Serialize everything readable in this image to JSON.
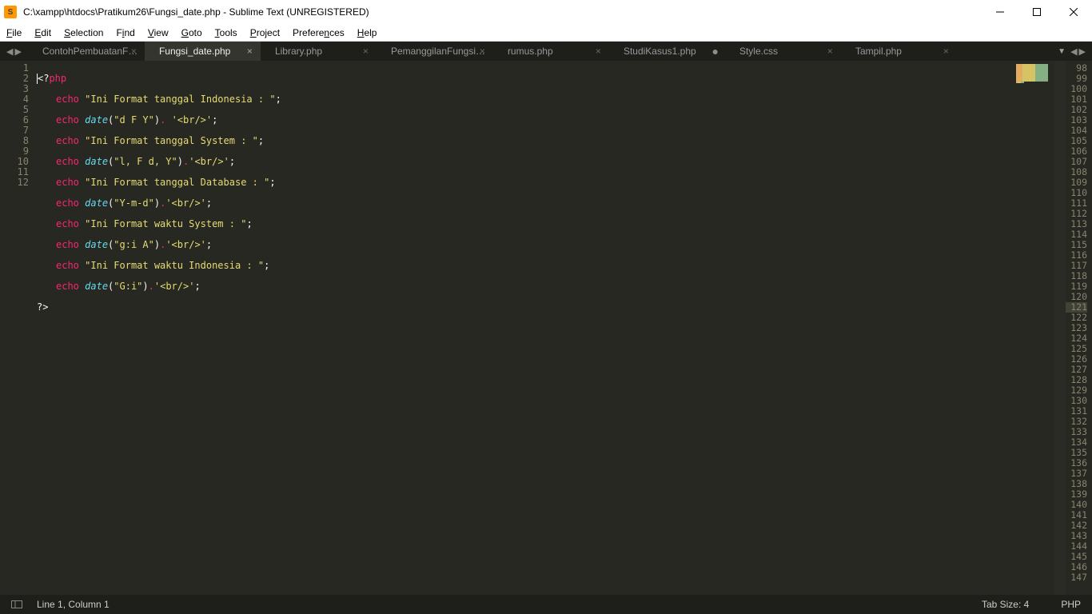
{
  "window": {
    "title": "C:\\xampp\\htdocs\\Pratikum26\\Fungsi_date.php - Sublime Text (UNREGISTERED)"
  },
  "menu": {
    "file": {
      "u": "F",
      "rest": "ile"
    },
    "edit": {
      "u": "E",
      "rest": "dit"
    },
    "selection": {
      "u": "S",
      "rest": "election"
    },
    "find": {
      "pre": "F",
      "u": "i",
      "rest": "nd"
    },
    "view": {
      "u": "V",
      "rest": "iew"
    },
    "goto": {
      "u": "G",
      "rest": "oto"
    },
    "tools": {
      "u": "T",
      "rest": "ools"
    },
    "project": {
      "u": "P",
      "rest": "roject"
    },
    "preferences": {
      "pre": "Prefere",
      "u": "n",
      "rest": "ces"
    },
    "help": {
      "u": "H",
      "rest": "elp"
    }
  },
  "tabs": [
    {
      "name": "ContohPembuatanFungsi.php",
      "close": "×"
    },
    {
      "name": "Fungsi_date.php",
      "close": "×",
      "active": true
    },
    {
      "name": "Library.php",
      "close": "×"
    },
    {
      "name": "PemanggilanFungsi.php",
      "close": "×"
    },
    {
      "name": "rumus.php",
      "close": "×"
    },
    {
      "name": "StudiKasus1.php",
      "dirty": "●"
    },
    {
      "name": "Style.css",
      "close": "×"
    },
    {
      "name": "Tampil.php",
      "close": "×"
    }
  ],
  "left_line_start": 1,
  "left_line_end": 12,
  "right_line_start": 98,
  "right_line_end": 147,
  "right_highlight": 121,
  "code": {
    "l1": {
      "open": "<?",
      "php": "php"
    },
    "echo": "echo",
    "date": "date",
    "l2": "\"Ini Format tanggal Indonesia : \"",
    "l3a": "\"d F Y\"",
    "l3b": "'<br/>'",
    "l4": "\"Ini Format tanggal System : \"",
    "l5a": "\"l, F d, Y\"",
    "l5b": "'<br/>'",
    "l6": "\"Ini Format tanggal Database : \"",
    "l7a": "\"Y-m-d\"",
    "l7b": "'<br/>'",
    "l8": "\"Ini Format waktu System : \"",
    "l9a": "\"g:i A\"",
    "l9b": "'<br/>'",
    "l10": "\"Ini Format waktu Indonesia : \"",
    "l11a": "\"G:i\"",
    "l11b": "'<br/>'",
    "l12": "?>"
  },
  "status": {
    "pos": "Line 1, Column 1",
    "tab": "Tab Size: 4",
    "lang": "PHP"
  }
}
